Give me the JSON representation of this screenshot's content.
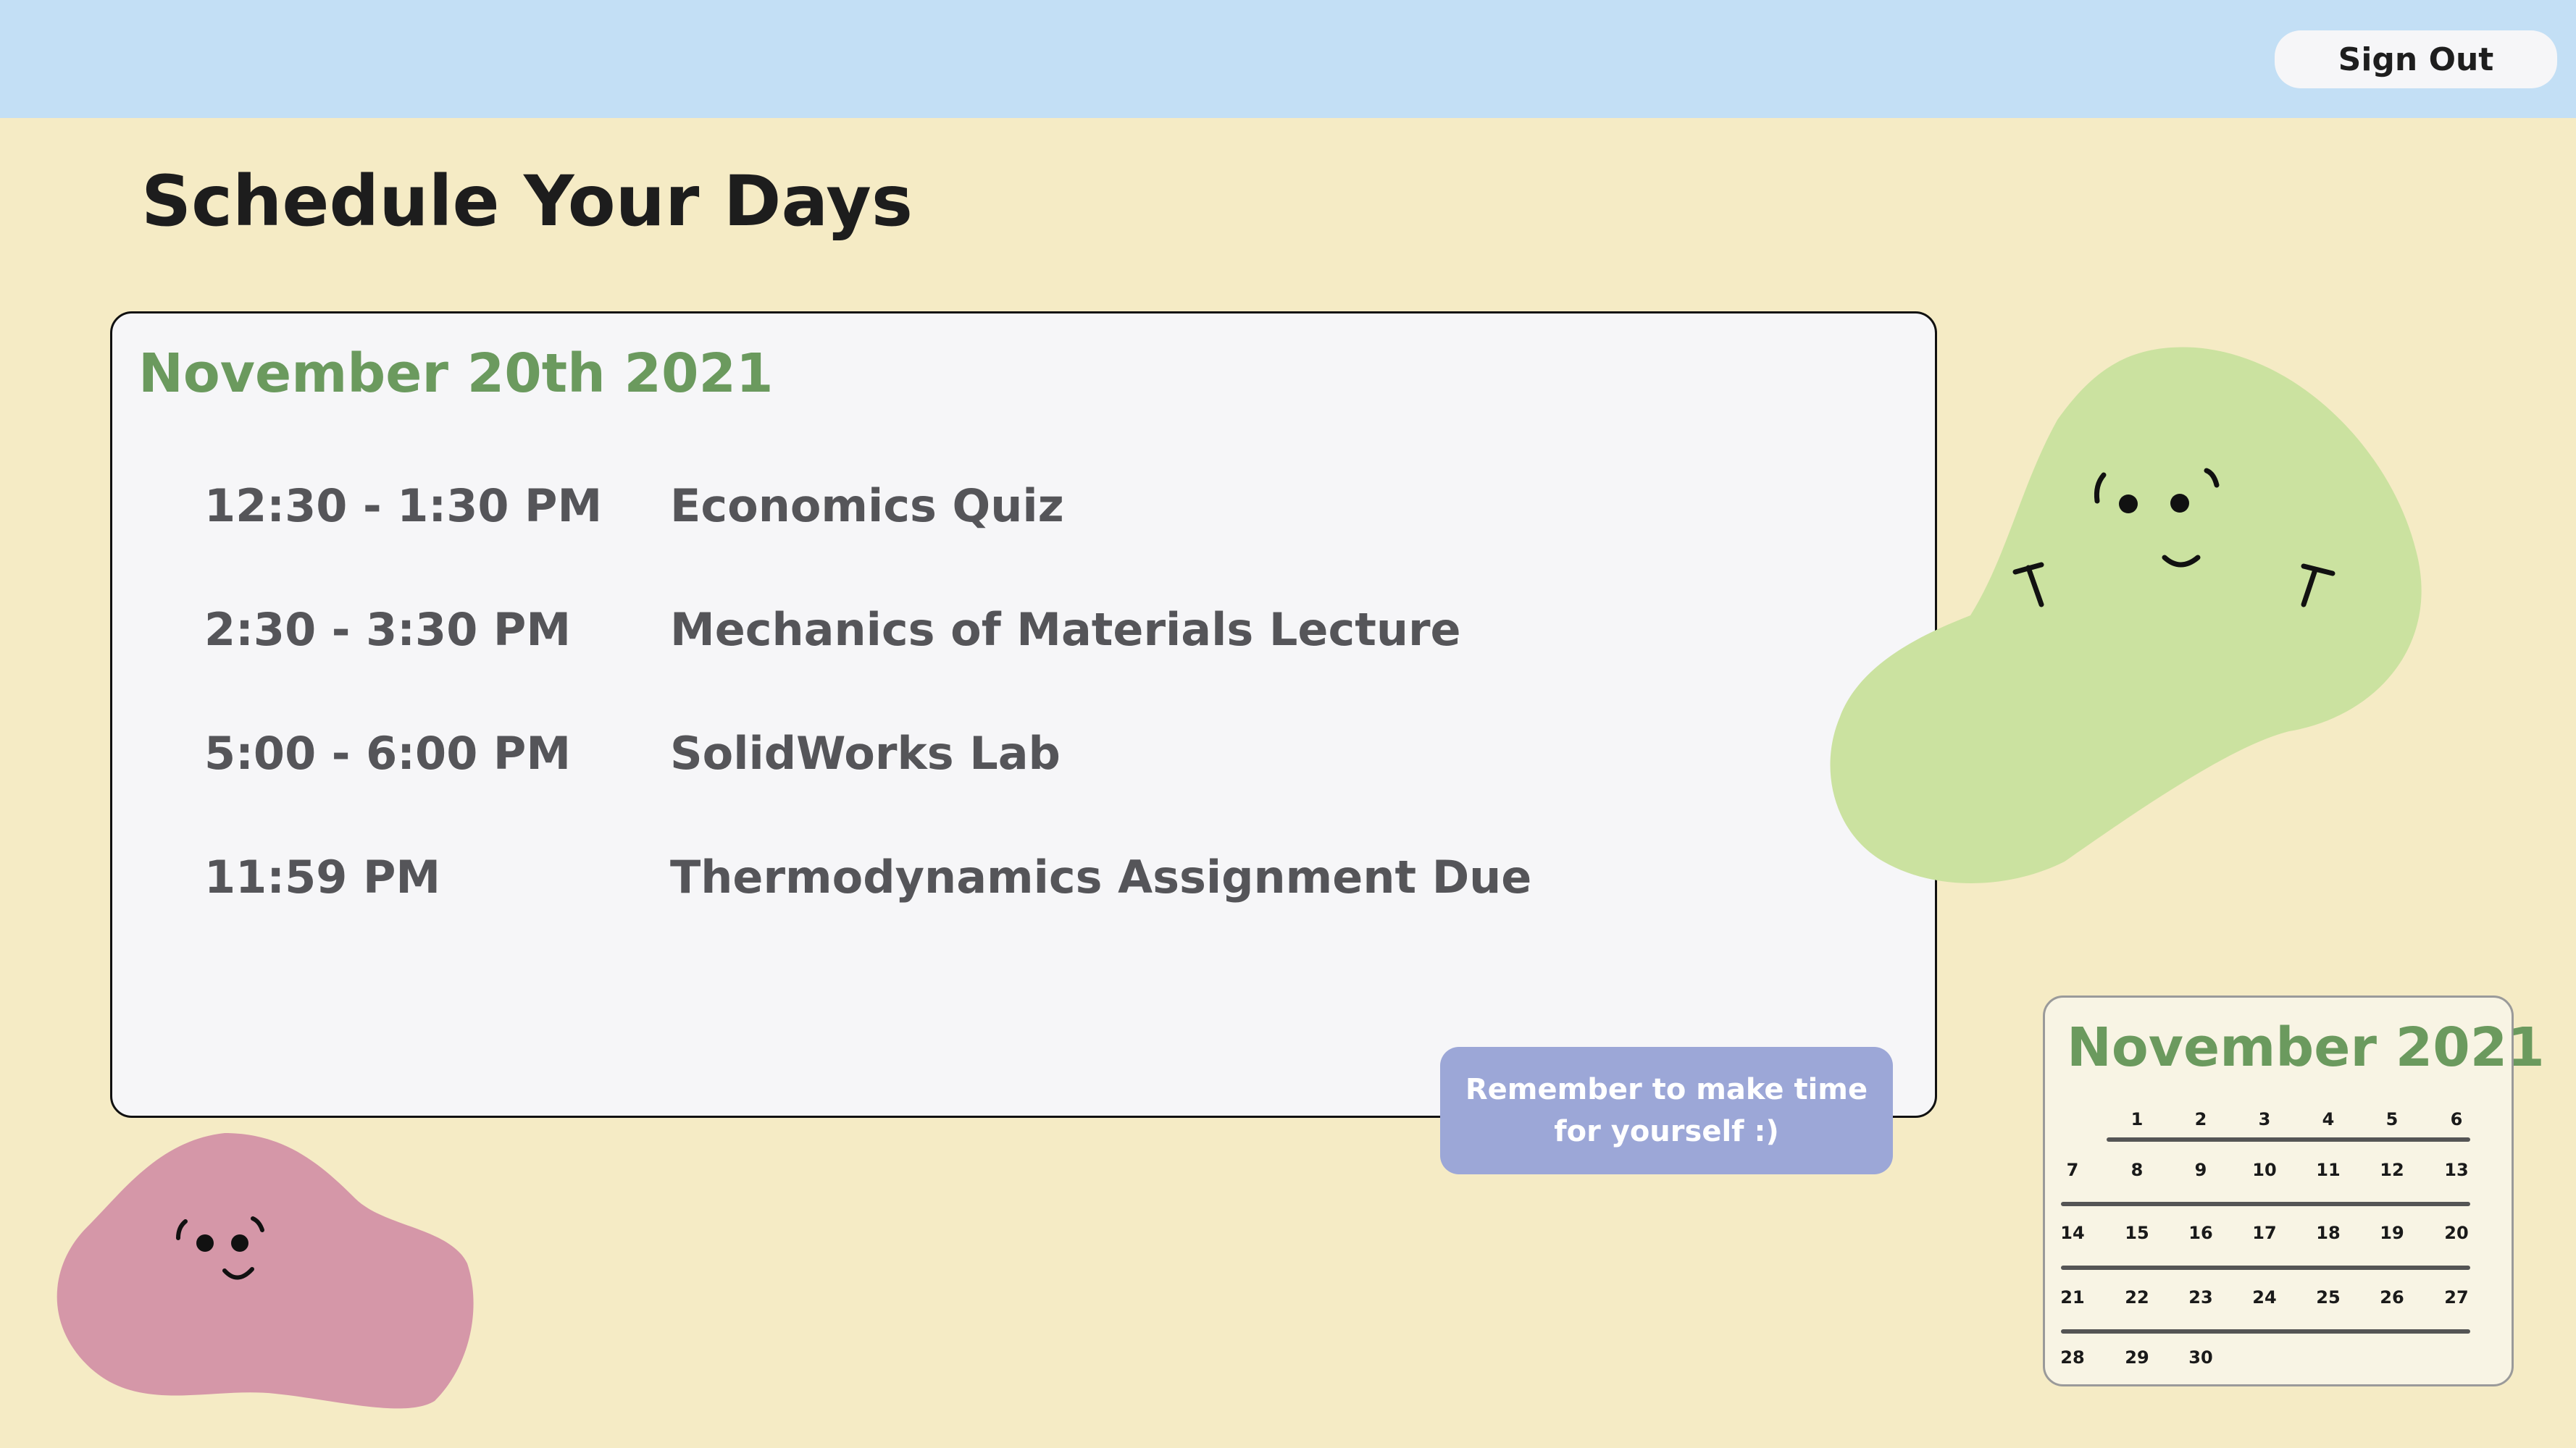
{
  "header": {
    "sign_out_label": "Sign Out"
  },
  "page": {
    "title": "Schedule Your Days"
  },
  "schedule": {
    "date": "November 20th 2021",
    "events": [
      {
        "time": "12:30 - 1:30 PM",
        "title": "Economics Quiz"
      },
      {
        "time": "2:30 - 3:30 PM",
        "title": "Mechanics of Materials Lecture"
      },
      {
        "time": "5:00 - 6:00 PM",
        "title": "SolidWorks Lab"
      },
      {
        "time": "11:59 PM",
        "title": "Thermodynamics Assignment Due"
      }
    ]
  },
  "reminder": {
    "line1": "Remember to make time",
    "line2": "for yourself :)"
  },
  "calendar": {
    "title": "November 2021",
    "selected_day": "20",
    "weeks": [
      [
        "",
        "1",
        "2",
        "3",
        "4",
        "5",
        "6"
      ],
      [
        "7",
        "8",
        "9",
        "10",
        "11",
        "12",
        "13"
      ],
      [
        "14",
        "15",
        "16",
        "17",
        "18",
        "19",
        "20"
      ],
      [
        "21",
        "22",
        "23",
        "24",
        "25",
        "26",
        "27"
      ],
      [
        "28",
        "29",
        "30",
        "",
        "",
        "",
        ""
      ]
    ]
  },
  "colors": {
    "background": "#F5EBC5",
    "header_bar": "#C3DFF5",
    "accent_green": "#6B9A5E",
    "green_blob": "#CBE2A0",
    "pink_blob": "#D597A8",
    "reminder_bg": "#9CA7D7"
  }
}
